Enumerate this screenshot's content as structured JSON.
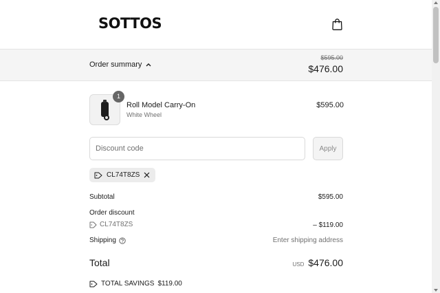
{
  "header": {
    "logo": "SOTTOS",
    "cart_icon": "shopping-bag-icon"
  },
  "summary": {
    "toggle_label": "Order summary",
    "original_price": "$595.00",
    "price": "$476.00"
  },
  "product": {
    "quantity": "1",
    "name": "Roll Model Carry-On",
    "variant": "White Wheel",
    "price": "$595.00"
  },
  "discount": {
    "placeholder": "Discount code",
    "apply_label": "Apply",
    "applied_code": "CL74T8ZS"
  },
  "totals": {
    "subtotal_label": "Subtotal",
    "subtotal_value": "$595.00",
    "order_discount_label": "Order discount",
    "order_discount_code": "CL74T8ZS",
    "order_discount_value": "– $119.00",
    "shipping_label": "Shipping",
    "shipping_value": "Enter shipping address",
    "total_label": "Total",
    "currency": "USD",
    "total_value": "$476.00",
    "savings_label": "TOTAL SAVINGS",
    "savings_value": "$119.00"
  }
}
